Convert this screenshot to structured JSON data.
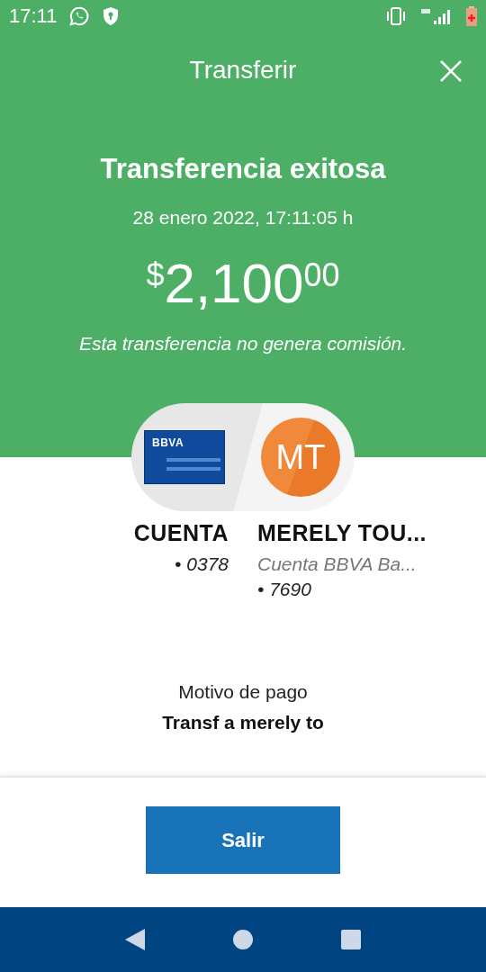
{
  "status_bar": {
    "time": "17:11"
  },
  "header": {
    "title": "Transferir"
  },
  "result": {
    "heading": "Transferencia exitosa",
    "date": "28 enero 2022, 17:11:05 h",
    "amount": {
      "currency": "$",
      "whole": "2,100",
      "cents": "00"
    },
    "note": "Esta transferencia no genera comisión."
  },
  "origin": {
    "bank_logo": "BBVA",
    "name": "CUENTA",
    "account": "• 0378"
  },
  "destination": {
    "initials": "MT",
    "name": "MERELY TOU...",
    "bank": "Cuenta BBVA Ba...",
    "account": "• 7690"
  },
  "payment_reason": {
    "label": "Motivo de pago",
    "value": "Transf a merely to"
  },
  "buttons": [
    {
      "label": "Salir"
    }
  ]
}
